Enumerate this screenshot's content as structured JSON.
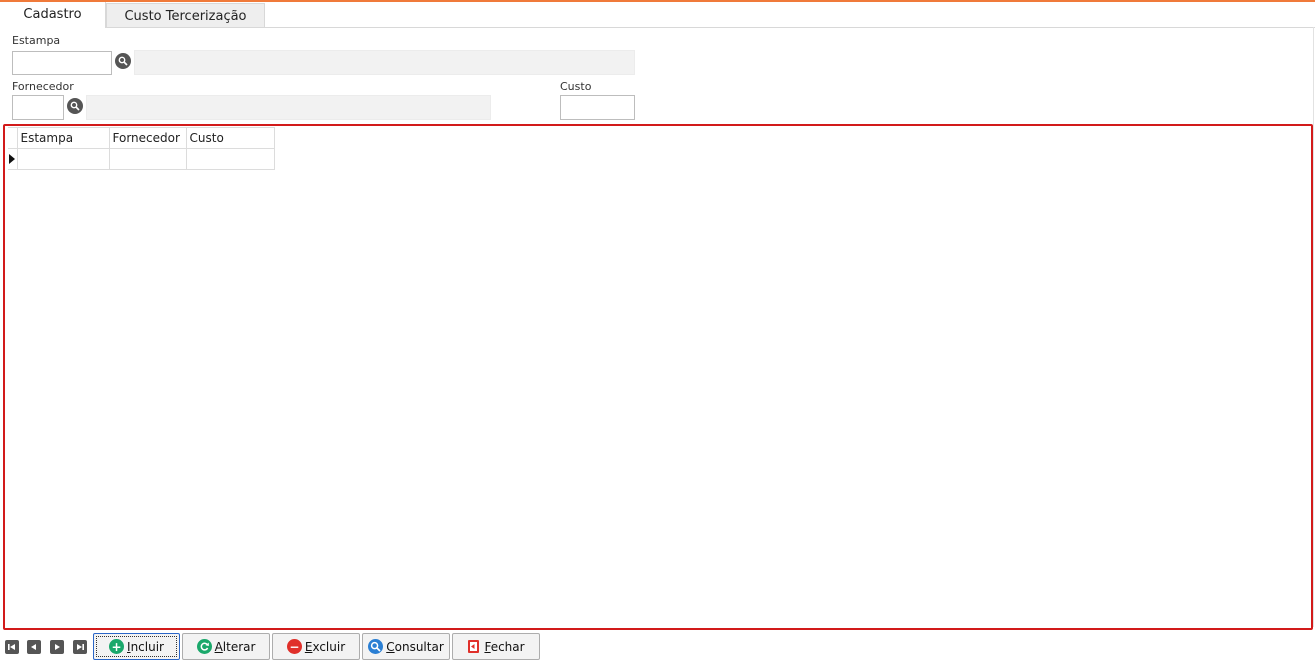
{
  "tabs": [
    {
      "label": "Cadastro",
      "active": true
    },
    {
      "label": "Custo Tercerização",
      "active": false
    }
  ],
  "form": {
    "estampa": {
      "label": "Estampa",
      "value": "",
      "description": ""
    },
    "fornecedor": {
      "label": "Fornecedor",
      "value": "",
      "description": ""
    },
    "custo": {
      "label": "Custo",
      "value": ""
    }
  },
  "grid": {
    "columns": [
      "Estampa",
      "Fornecedor",
      "Custo"
    ],
    "rows": [
      [
        "",
        "",
        ""
      ]
    ]
  },
  "buttons": {
    "incluir": {
      "accel": "I",
      "rest": "ncluir"
    },
    "alterar": {
      "accel": "A",
      "rest": "lterar"
    },
    "excluir": {
      "accel": "E",
      "rest": "xcluir"
    },
    "consultar": {
      "accel": "C",
      "rest": "onsultar"
    },
    "fechar": {
      "accel": "F",
      "rest": "echar"
    }
  },
  "colors": {
    "accent": "#f07a3a",
    "grid_border": "#d21a1a",
    "incluir": "#1aa86b",
    "alterar": "#1aa86b",
    "excluir": "#e0302a",
    "consultar": "#2a7fd4",
    "fechar": "#e0302a"
  }
}
